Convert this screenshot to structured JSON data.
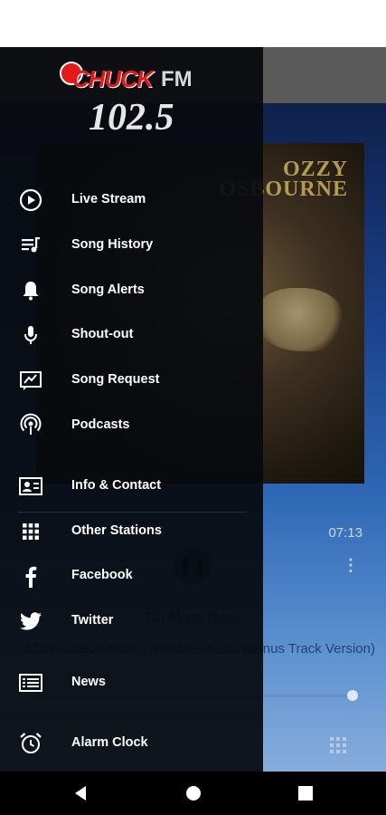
{
  "app": {
    "now_playing": {
      "album_text": "OZZY\nOSBOURNE",
      "time": "07:13",
      "track_title": "No More Tears",
      "track_subtitle": "OZZY OSBOURNE - No More Tears (Bonus Track Version)"
    }
  },
  "drawer": {
    "logo": {
      "brand": "CHUCK",
      "band": "FM",
      "frequency": "102.5"
    },
    "items": [
      {
        "label": "Live Stream",
        "icon": "play-circle-icon"
      },
      {
        "label": "Song History",
        "icon": "playlist-icon"
      },
      {
        "label": "Song Alerts",
        "icon": "bell-icon"
      },
      {
        "label": "Shout-out",
        "icon": "microphone-icon"
      },
      {
        "label": "Song Request",
        "icon": "request-icon"
      },
      {
        "label": "Podcasts",
        "icon": "podcast-icon"
      },
      {
        "label": "Info & Contact",
        "icon": "contact-card-icon"
      },
      {
        "label": "Other Stations",
        "icon": "grid-icon"
      },
      {
        "label": "Facebook",
        "icon": "facebook-icon"
      },
      {
        "label": "Twitter",
        "icon": "twitter-icon"
      },
      {
        "label": "News",
        "icon": "news-icon"
      },
      {
        "label": "Alarm Clock",
        "icon": "alarm-clock-icon"
      }
    ]
  },
  "colors": {
    "drawer_bg": "#08090c",
    "accent_red": "#e21a1a",
    "nav_bar": "#000000"
  },
  "navbar": {
    "icons": [
      "back-icon",
      "home-icon",
      "recents-icon"
    ]
  }
}
